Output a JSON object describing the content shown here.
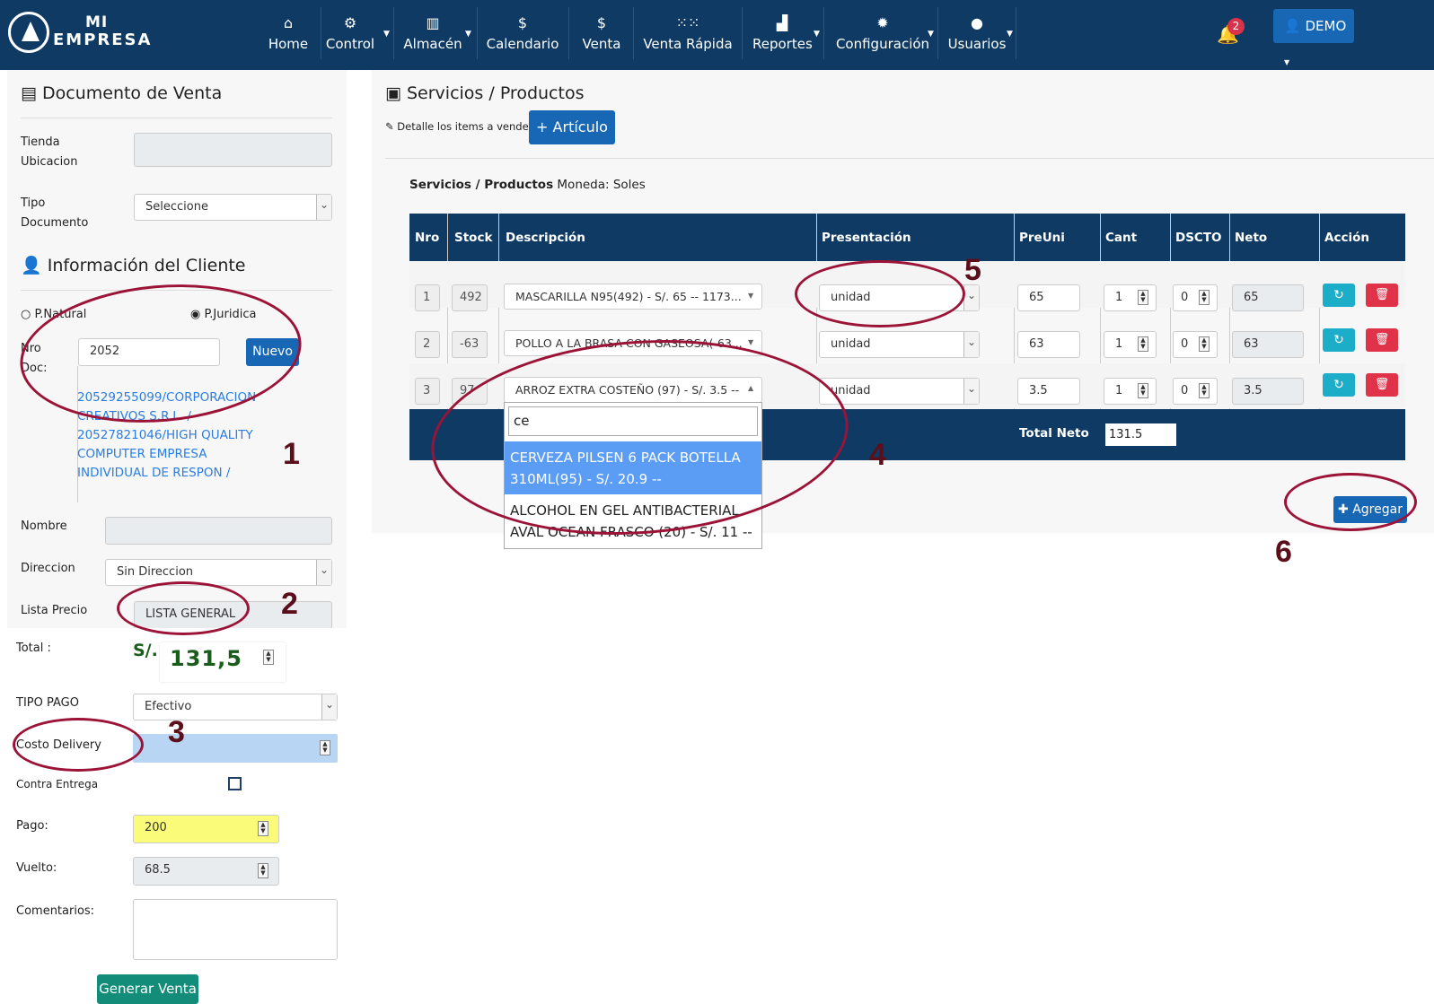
{
  "navbar": {
    "brand_line1": "MI",
    "brand_line2": "EMPRESA",
    "items": [
      {
        "label": "Home",
        "icon": "home-icon"
      },
      {
        "label": "Control",
        "icon": "cogs-icon"
      },
      {
        "label": "Almacén",
        "icon": "building-icon"
      },
      {
        "label": "Calendario",
        "icon": "dollar-icon"
      },
      {
        "label": "Venta",
        "icon": "dollar-icon"
      },
      {
        "label": "Venta Rápida",
        "icon": "grid-icon"
      },
      {
        "label": "Reportes",
        "icon": "chart-icon"
      },
      {
        "label": "Configuración",
        "icon": "gear-icon"
      },
      {
        "label": "Usuarios",
        "icon": "user-icon"
      }
    ],
    "notification_count": "2",
    "user_label": "DEMO"
  },
  "doc": {
    "title": "Documento de Venta",
    "tienda_label": "Tienda Ubicacion",
    "tipo_label": "Tipo Documento",
    "tipo_value": "Seleccione"
  },
  "cliente": {
    "title": "Información del Cliente",
    "natural_label": "P.Natural",
    "juridica_label": "P.Juridica",
    "nrodoc_label": "Nro Doc:",
    "nrodoc_value": "2052",
    "nuevo_label": "Nuevo",
    "suggestions": [
      "20529255099/CORPORACION CREATIVOS S.R.L. /",
      "20527821046/HIGH QUALITY COMPUTER EMPRESA INDIVIDUAL DE RESPON /"
    ],
    "nombre_label": "Nombre",
    "direccion_label": "Direccion",
    "direccion_value": "Sin Direccion",
    "lista_label": "Lista Precio",
    "lista_value": "LISTA GENERAL"
  },
  "pago": {
    "total_label": "Total :",
    "currency": "S/.",
    "total_value": "131,5",
    "tipo_pago_label": "TIPO PAGO",
    "tipo_pago_value": "Efectivo",
    "delivery_label": "Costo Delivery",
    "contra_label": "Contra Entrega",
    "pago_label": "Pago:",
    "pago_value": "200",
    "vuelto_label": "Vuelto:",
    "vuelto_value": "68.5",
    "comentarios_label": "Comentarios:",
    "generar_label": "Generar Venta"
  },
  "servicios": {
    "title": "Servicios / Productos",
    "detalle_label": "Detalle los items a vender",
    "articulo_label": "+ Artículo",
    "section_bold": "Servicios / Productos",
    "moneda_label": "Moneda: Soles",
    "columns": [
      "Nro",
      "Stock",
      "Descripción",
      "Presentación",
      "PreUni",
      "Cant",
      "DSCTO",
      "Neto",
      "Acción"
    ],
    "rows": [
      {
        "nro": "1",
        "stock": "492",
        "desc": "MASCARILLA N95(492) - S/. 65 -- 1173...",
        "pres": "unidad",
        "preuni": "65",
        "cant": "1",
        "dscto": "0",
        "neto": "65"
      },
      {
        "nro": "2",
        "stock": "-63",
        "desc": "POLLO A LA BRASA CON GASEOSA(-63...",
        "pres": "unidad",
        "preuni": "63",
        "cant": "1",
        "dscto": "0",
        "neto": "63"
      },
      {
        "nro": "3",
        "stock": "97",
        "desc": "ARROZ EXTRA COSTEÑO (97) - S/. 3.5 --",
        "pres": "unidad",
        "preuni": "3.5",
        "cant": "1",
        "dscto": "0",
        "neto": "3.5"
      }
    ],
    "total_neto_label": "Total Neto",
    "total_neto_value": "131.5",
    "search_value": "ce",
    "dropdown_options": [
      "CERVEZA PILSEN 6 PACK BOTELLA 310ML(95) - S/. 20.9 --",
      "ALCOHOL EN GEL ANTIBACTERIAL AVAL OCEAN FRASCO (20) - S/. 11 --"
    ],
    "agregar_label": "Agregar"
  },
  "annotations": [
    "1",
    "2",
    "3",
    "4",
    "5",
    "6"
  ]
}
